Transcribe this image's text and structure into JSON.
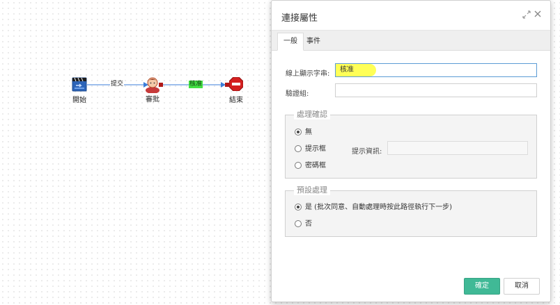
{
  "flow": {
    "nodes": {
      "start": {
        "label": "開始",
        "icon": "start-icon"
      },
      "approve": {
        "label": "審批",
        "icon": "user-task-icon"
      },
      "end": {
        "label": "結束",
        "icon": "end-stop-icon"
      }
    },
    "edges": {
      "submit": {
        "label": "提交"
      },
      "approved": {
        "label": "核准",
        "selected": true
      }
    }
  },
  "dialog": {
    "title": "連接屬性",
    "expand_icon": "expand-icon",
    "close_icon": "close-icon",
    "tabs": [
      {
        "label": "一般",
        "active": true
      },
      {
        "label": "事件",
        "active": false
      }
    ],
    "display_text": {
      "label": "線上顯示字串:",
      "value": "核准"
    },
    "validation_group": {
      "label": "驗證組:",
      "value": ""
    },
    "confirm_section": {
      "legend": "處理確認",
      "options": [
        {
          "label": "無",
          "checked": true
        },
        {
          "label": "提示框",
          "checked": false
        },
        {
          "label": "密碼框",
          "checked": false
        }
      ],
      "prompt_info": {
        "label": "提示資訊:",
        "value": ""
      }
    },
    "default_section": {
      "legend": "預設處理",
      "options": [
        {
          "label": "是 (批次同意、自動處理時按此路徑執行下一步)",
          "checked": true
        },
        {
          "label": "否",
          "checked": false
        }
      ]
    },
    "buttons": {
      "ok": "確定",
      "cancel": "取消"
    }
  },
  "colors": {
    "accent": "#40b996",
    "selected_edge": "#43e043",
    "highlight": "#ffff3a"
  }
}
